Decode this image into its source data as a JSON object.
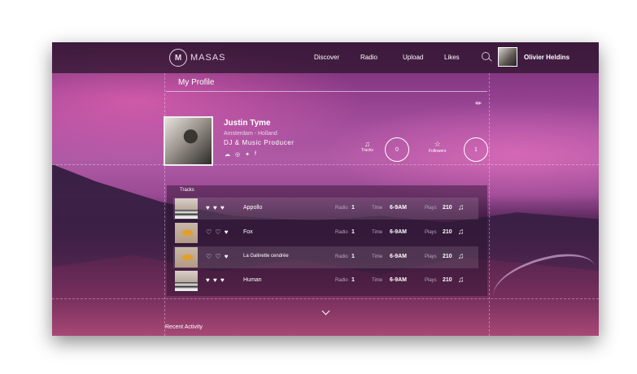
{
  "nav": {
    "logo_mark": "M",
    "logo_text": "MASAS",
    "items": [
      "Discover",
      "Radio",
      "Upload",
      "Likes"
    ],
    "search_icon": "search-icon",
    "user_name": "Olivier Heldins"
  },
  "page": {
    "title": "My Profile"
  },
  "profile": {
    "name": "Justin Tyme",
    "location": "Amsterdam - Holland",
    "role": "DJ & Music Producer",
    "socials": [
      "soundcloud-icon",
      "globe-icon",
      "twitter-icon",
      "facebook-icon"
    ]
  },
  "stats": {
    "tracks_label": "Tracks",
    "tracks_count": "0",
    "followers_label": "Followers",
    "followers_count": "1"
  },
  "tracks": {
    "title": "Tracks",
    "columns": {
      "radio": "Radio",
      "time": "Time",
      "plays": "Plays"
    },
    "rows": [
      {
        "name": "Appollo",
        "radio": "1",
        "time": "6-9AM",
        "plays": "210",
        "likes": "♥ ♥ ♥"
      },
      {
        "name": "Fox",
        "radio": "1",
        "time": "6-9AM",
        "plays": "210",
        "likes": "♡ ♡ ♥"
      },
      {
        "name": "La Galinette cendrée",
        "radio": "1",
        "time": "6-9AM",
        "plays": "210",
        "likes": "♡ ♡ ♥"
      },
      {
        "name": "Human",
        "radio": "1",
        "time": "6-9AM",
        "plays": "210",
        "likes": "♥ ♥ ♥"
      }
    ]
  },
  "recent": {
    "title": "Recent Activity"
  },
  "colors": {
    "accent": "#b05aa5",
    "nav_bg": "#2d142d"
  }
}
